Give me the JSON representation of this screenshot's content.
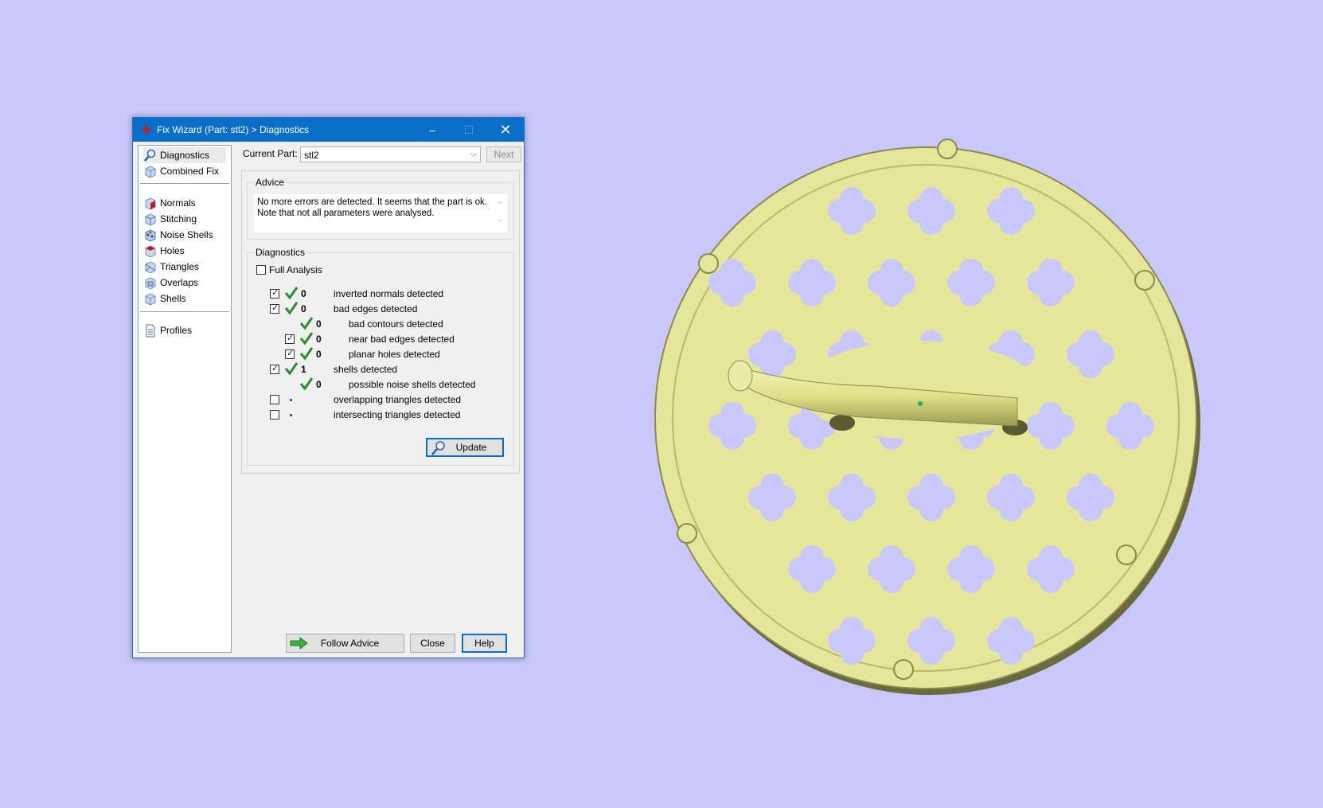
{
  "window": {
    "title": "Fix Wizard (Part: stl2) > Diagnostics",
    "controls": {
      "minimize": "–",
      "maximize": "☐",
      "close": "✕"
    }
  },
  "sidebar": {
    "items": [
      {
        "label": "Diagnostics",
        "icon": "magnifier-icon",
        "active": true
      },
      {
        "label": "Combined Fix",
        "icon": "cube-icon"
      },
      {
        "label": "Normals",
        "icon": "normals-cube-icon"
      },
      {
        "label": "Stitching",
        "icon": "stitching-cube-icon"
      },
      {
        "label": "Noise Shells",
        "icon": "noise-shells-icon"
      },
      {
        "label": "Holes",
        "icon": "holes-cube-icon"
      },
      {
        "label": "Triangles",
        "icon": "triangles-cube-icon"
      },
      {
        "label": "Overlaps",
        "icon": "overlaps-cube-icon"
      },
      {
        "label": "Shells",
        "icon": "shells-cube-icon"
      },
      {
        "label": "Profiles",
        "icon": "document-icon"
      }
    ]
  },
  "current_part": {
    "label": "Current Part:",
    "value": "stl2",
    "next_label": "Next"
  },
  "advice": {
    "legend": "Advice",
    "line1": "No more errors are detected. It seems that the part is ok.",
    "line2": "Note that not all parameters were analysed."
  },
  "diagnostics": {
    "legend": "Diagnostics",
    "full_analysis": {
      "label": "Full Analysis",
      "checked": false
    },
    "rows": [
      {
        "checkbox": true,
        "checked": true,
        "status": "ok",
        "count": "0",
        "label": "inverted normals detected",
        "indent": 0
      },
      {
        "checkbox": true,
        "checked": true,
        "status": "ok",
        "count": "0",
        "label": "bad edges detected",
        "indent": 0
      },
      {
        "checkbox": false,
        "status": "ok",
        "count": "0",
        "label": "bad contours detected",
        "indent": 1
      },
      {
        "checkbox": true,
        "checked": true,
        "status": "ok",
        "count": "0",
        "label": "near bad edges detected",
        "indent": 1
      },
      {
        "checkbox": true,
        "checked": true,
        "status": "ok",
        "count": "0",
        "label": "planar holes detected",
        "indent": 1
      },
      {
        "checkbox": true,
        "checked": true,
        "status": "ok",
        "count": "1",
        "label": "shells detected",
        "indent": 0
      },
      {
        "checkbox": false,
        "status": "ok",
        "count": "0",
        "label": "possible noise shells detected",
        "indent": 1
      },
      {
        "checkbox": true,
        "checked": false,
        "status": "none",
        "count": "",
        "label": "overlapping triangles detected",
        "indent": 0
      },
      {
        "checkbox": true,
        "checked": false,
        "status": "none",
        "count": "",
        "label": "intersecting triangles detected",
        "indent": 0
      }
    ],
    "update_label": "Update"
  },
  "footer": {
    "follow_advice": "Follow Advice",
    "close": "Close",
    "help": "Help"
  },
  "colors": {
    "titlebar": "#0a6ec8",
    "background": "#c8c8fa",
    "part": "#e6e69a",
    "check": "#2e8b2e"
  }
}
